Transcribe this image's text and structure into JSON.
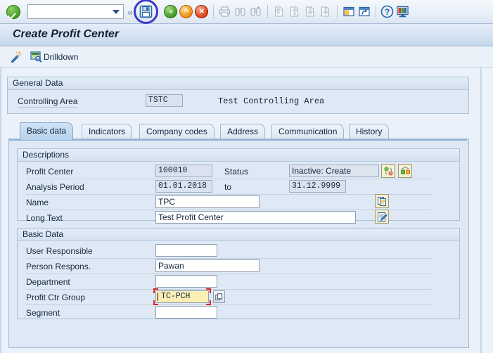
{
  "toolbar": {
    "ok_icon": "green-check-icon",
    "command_field_value": "",
    "command_field_placeholder": "",
    "back_icon": "back-chevrons-icon",
    "save_icon": "save-floppy-icon",
    "save_highlight_color": "#3b39c6",
    "buttons": [
      {
        "name": "back-button",
        "icon": "green-back-circle-icon"
      },
      {
        "name": "exit-button",
        "icon": "orange-up-circle-icon"
      },
      {
        "name": "cancel-button",
        "icon": "red-cancel-circle-icon"
      },
      {
        "name": "print-button",
        "icon": "printer-icon"
      },
      {
        "name": "find-button",
        "icon": "binoculars-icon"
      },
      {
        "name": "find-next-button",
        "icon": "binoculars-plus-icon"
      },
      {
        "name": "first-page-button",
        "icon": "first-page-icon"
      },
      {
        "name": "previous-page-button",
        "icon": "previous-page-icon"
      },
      {
        "name": "next-page-button",
        "icon": "next-page-icon"
      },
      {
        "name": "last-page-button",
        "icon": "last-page-icon"
      },
      {
        "name": "create-session-button",
        "icon": "new-session-icon"
      },
      {
        "name": "create-shortcut-button",
        "icon": "shortcut-icon"
      },
      {
        "name": "help-button",
        "icon": "help-question-icon"
      },
      {
        "name": "customize-layout-button",
        "icon": "layout-monitor-icon"
      }
    ]
  },
  "title": "Create Profit Center",
  "app_toolbar": {
    "wand_icon": "magic-wand-icon",
    "drilldown_icon": "drilldown-monitor-icon",
    "drilldown_label": "Drilldown"
  },
  "general_data": {
    "group_title": "General Data",
    "controlling_area_label": "Controlling Area",
    "controlling_area_value": "TSTC",
    "controlling_area_text": "Test Controlling Area"
  },
  "tabs": [
    {
      "label": "Basic data",
      "active": true
    },
    {
      "label": "Indicators",
      "active": false
    },
    {
      "label": "Company codes",
      "active": false
    },
    {
      "label": "Address",
      "active": false
    },
    {
      "label": "Communication",
      "active": false
    },
    {
      "label": "History",
      "active": false
    }
  ],
  "descriptions": {
    "group_title": "Descriptions",
    "profit_center_label": "Profit Center",
    "profit_center_value": "100010",
    "status_label": "Status",
    "status_value": "Inactive: Create",
    "status_icon_1": "status-change-icon",
    "status_icon_2": "activate-icon",
    "analysis_period_label": "Analysis Period",
    "analysis_period_from": "01.01.2018",
    "analysis_period_to_label": "to",
    "analysis_period_to": "31.12.9999",
    "name_label": "Name",
    "name_value": "TPC",
    "name_icon": "copy-document-icon",
    "long_text_label": "Long Text",
    "long_text_value": "Test Profit Center",
    "long_text_icon": "edit-document-icon"
  },
  "basic_data": {
    "group_title": "Basic Data",
    "user_responsible_label": "User Responsible",
    "user_responsible_value": "",
    "person_respons_label": "Person Respons.",
    "person_respons_value": "Pawan",
    "department_label": "Department",
    "department_value": "",
    "profit_ctr_group_label": "Profit Ctr Group",
    "profit_ctr_group_value": "TC-PCH",
    "profit_ctr_group_f4_icon": "value-help-icon",
    "segment_label": "Segment",
    "segment_value": ""
  },
  "colors": {
    "accent": "#3b39c6",
    "focus_field_bg": "#fbefb6",
    "panel_bg": "#dfe9f5",
    "page_bg": "#eaf1fa"
  }
}
